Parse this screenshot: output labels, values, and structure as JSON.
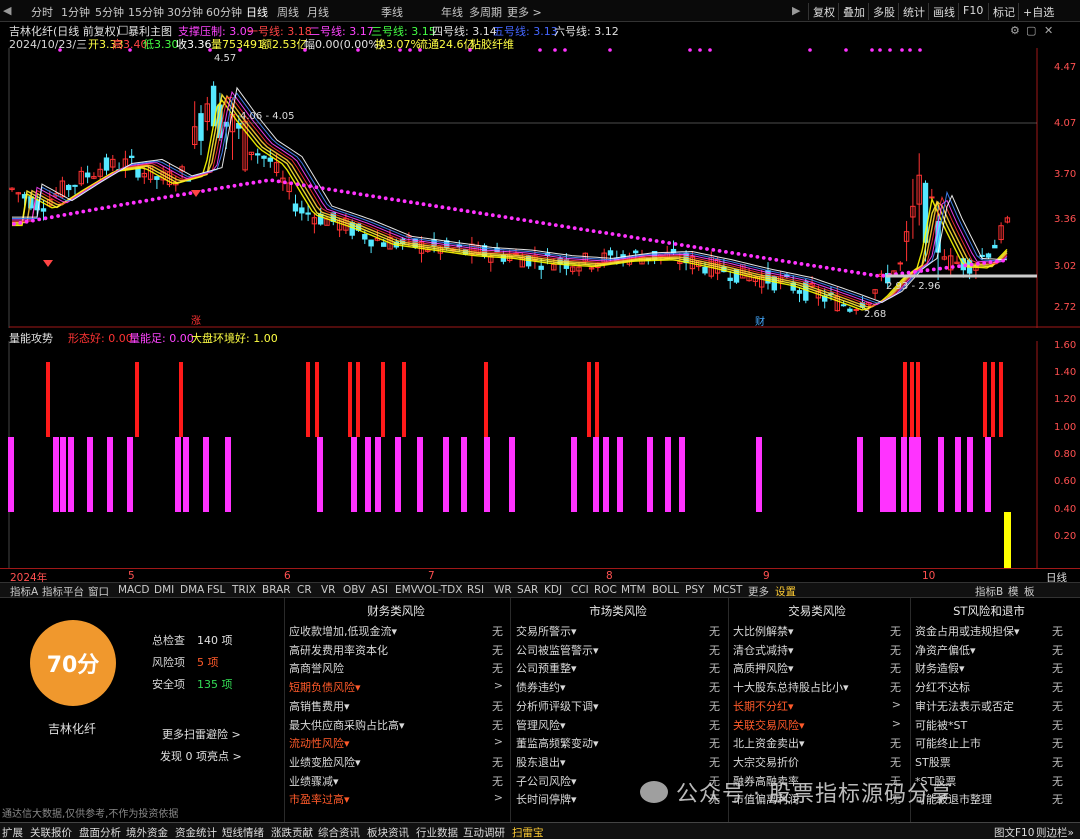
{
  "toolbar": {
    "left_items": [
      "分时",
      "1分钟",
      "5分钟",
      "15分钟",
      "30分钟",
      "60分钟",
      "日线",
      "周线",
      "月线",
      "季线",
      "年线",
      "多周期",
      "更多 >"
    ],
    "right_items": [
      "复权",
      "叠加",
      "多股",
      "统计",
      "画线",
      "F10",
      "标记",
      "+自选"
    ],
    "nav_left": "◀",
    "nav_right": "▶"
  },
  "info": {
    "stock_name": "吉林化纤(日线 前复权)",
    "indicator_name": "暴利主图",
    "resist_label": "支撑压制: 3.09",
    "line1": "一号线: 3.18",
    "line2": "二号线: 3.17",
    "line3": "三号线: 3.15",
    "line4": "四号线: 3.14",
    "line5": "五号线: 3.13",
    "line6": "六号线: 3.12",
    "date": "2024/10/23/三",
    "open": "开3.33",
    "high": "高3.40",
    "low": "低3.30",
    "close": "收3.36",
    "volume": "量753491",
    "amount": "额2.53亿",
    "width": "幅0.00(0.00%)",
    "turnover": "换3.07%",
    "float": "流通24.6亿",
    "tag": "粘胶纤维"
  },
  "chart_labels": {
    "peak_label": "4.57",
    "range_label": "4.06 - 4.05",
    "low_label": "2.68",
    "box_label": "2.93 - 2.96",
    "marker_zhang": "涨",
    "marker_cai": "财",
    "y_ticks": [
      "4.47",
      "4.07",
      "3.70",
      "3.36",
      "3.02",
      "2.72"
    ]
  },
  "vol_panel": {
    "name": "量能攻势",
    "l1": "形态好: 0.00",
    "l2": "量能足: 0.00",
    "l3": "大盘环境好: 1.00",
    "y_ticks": [
      "1.60",
      "1.40",
      "1.20",
      "1.00",
      "0.80",
      "0.60",
      "0.40",
      "0.20"
    ]
  },
  "x_axis": {
    "labels": [
      "2024年",
      "5",
      "6",
      "7",
      "8",
      "9",
      "10"
    ],
    "right": "日线"
  },
  "indicator_tabs": [
    "指标A",
    "指标平台",
    "窗口",
    "MACD",
    "DMI",
    "DMA",
    "FSL",
    "TRIX",
    "BRAR",
    "CR",
    "VR",
    "OBV",
    "ASI",
    "EMV",
    "VOL-TDX",
    "RSI",
    "WR",
    "SAR",
    "KDJ",
    "CCI",
    "ROC",
    "MTM",
    "BOLL",
    "PSY",
    "MCST",
    "更多",
    "设置"
  ],
  "indicator_tabs_right": [
    "指标B",
    "模",
    "板"
  ],
  "risk": {
    "score": "70分",
    "total_label": "总检查",
    "total_value": "140 项",
    "risk_label": "风险项",
    "risk_value": "5 项",
    "safe_label": "安全项",
    "safe_value": "135 项",
    "stock": "吉林化纤",
    "more_scan": "更多扫雷避险 >",
    "found": "发现 0 项亮点 >",
    "disclaimer": "通达信大数据,仅供参考,不作为投资依据",
    "columns": [
      {
        "title": "财务类风险",
        "rows": [
          {
            "label": "应收款增加,低现金流▾",
            "val": "无",
            "warn": false
          },
          {
            "label": "高研发费用率资本化",
            "val": "无",
            "warn": false
          },
          {
            "label": "高商誉风险",
            "val": "无",
            "warn": false
          },
          {
            "label": "短期负债风险▾",
            "val": ">",
            "warn": true
          },
          {
            "label": "高销售费用▾",
            "val": "无",
            "warn": false
          },
          {
            "label": "最大供应商采购占比高▾",
            "val": "无",
            "warn": false
          },
          {
            "label": "流动性风险▾",
            "val": ">",
            "warn": true
          },
          {
            "label": "业绩变脸风险▾",
            "val": "无",
            "warn": false
          },
          {
            "label": "业绩骤减▾",
            "val": "无",
            "warn": false
          },
          {
            "label": "市盈率过高▾",
            "val": ">",
            "warn": true
          }
        ]
      },
      {
        "title": "市场类风险",
        "rows": [
          {
            "label": "交易所警示▾",
            "val": "无",
            "warn": false
          },
          {
            "label": "公司被监管警示▾",
            "val": "无",
            "warn": false
          },
          {
            "label": "公司预重整▾",
            "val": "无",
            "warn": false
          },
          {
            "label": "债券违约▾",
            "val": "无",
            "warn": false
          },
          {
            "label": "分析师评级下调▾",
            "val": "无",
            "warn": false
          },
          {
            "label": "管理风险▾",
            "val": "无",
            "warn": false
          },
          {
            "label": "董监高频繁变动▾",
            "val": "无",
            "warn": false
          },
          {
            "label": "股东退出▾",
            "val": "无",
            "warn": false
          },
          {
            "label": "子公司风险▾",
            "val": "无",
            "warn": false
          },
          {
            "label": "长时间停牌▾",
            "val": "无",
            "warn": false
          }
        ]
      },
      {
        "title": "交易类风险",
        "rows": [
          {
            "label": "大比例解禁▾",
            "val": "无",
            "warn": false
          },
          {
            "label": "清仓式减持▾",
            "val": "无",
            "warn": false
          },
          {
            "label": "高质押风险▾",
            "val": "无",
            "warn": false
          },
          {
            "label": "十大股东总持股占比小▾",
            "val": "无",
            "warn": false
          },
          {
            "label": "长期不分红▾",
            "val": ">",
            "warn": true
          },
          {
            "label": "关联交易风险▾",
            "val": ">",
            "warn": true
          },
          {
            "label": "北上资金卖出▾",
            "val": "无",
            "warn": false
          },
          {
            "label": "大宗交易折价",
            "val": "无",
            "warn": false
          },
          {
            "label": "融券高融卖率",
            "val": "无",
            "warn": false
          },
          {
            "label": "市值偏离利润",
            "val": "无",
            "warn": false
          }
        ]
      },
      {
        "title": "ST风险和退市",
        "rows": [
          {
            "label": "资金占用或违规担保▾",
            "val": "无",
            "warn": false
          },
          {
            "label": "净资产偏低▾",
            "val": "无",
            "warn": false
          },
          {
            "label": "财务造假▾",
            "val": "无",
            "warn": false
          },
          {
            "label": "分红不达标",
            "val": "无",
            "warn": false
          },
          {
            "label": "审计无法表示或否定",
            "val": "无",
            "warn": false
          },
          {
            "label": "可能被*ST",
            "val": "无",
            "warn": false
          },
          {
            "label": "可能终止上市",
            "val": "无",
            "warn": false
          },
          {
            "label": "ST股票",
            "val": "无",
            "warn": false
          },
          {
            "label": "*ST股票",
            "val": "无",
            "warn": false
          },
          {
            "label": "可能被退市整理",
            "val": "无",
            "warn": false
          }
        ]
      }
    ]
  },
  "watermark": "公众号 · 股票指标源码分享",
  "statusbar": [
    "扩展",
    "关联报价",
    "盘面分析",
    "境外资金",
    "资金统计",
    "短线情绪",
    "涨跌贡献",
    "综合资讯",
    "板块资讯",
    "行业数据",
    "互动调研",
    "扫雷宝"
  ],
  "statusbar_right": [
    "图文F10",
    "则边栏»"
  ],
  "colors": {
    "up": "#ff3333",
    "down": "#55e8ff",
    "yellow": "#ffff00",
    "magenta": "#ff33ff",
    "orange": "#f0982d"
  }
}
